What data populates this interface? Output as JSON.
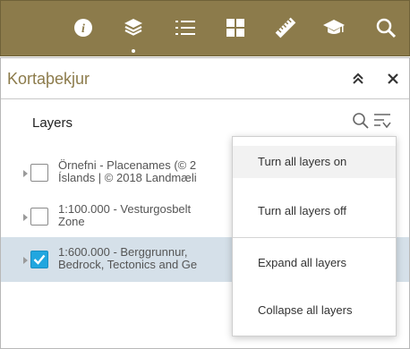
{
  "toolbar": {
    "buttons": [
      {
        "name": "info-icon"
      },
      {
        "name": "layers-icon",
        "active": true
      },
      {
        "name": "legend-list-icon"
      },
      {
        "name": "basemap-grid-icon"
      },
      {
        "name": "measure-ruler-icon"
      },
      {
        "name": "education-cap-icon"
      },
      {
        "name": "search-icon"
      }
    ],
    "background": "#8c7b4b"
  },
  "panel": {
    "title": "Kortaþekjur",
    "collapse_icon": "double-chevron-up-icon",
    "close_icon": "close-icon"
  },
  "layers": {
    "heading": "Layers",
    "items": [
      {
        "line1": "Örnefni - Placenames (© 2",
        "line2": "Íslands | © 2018 Landmæli",
        "checked": false
      },
      {
        "line1": "1:100.000 - Vesturgosbelt",
        "line2": "Zone",
        "checked": false
      },
      {
        "line1": "1:600.000 - Berggrunnur,",
        "line2": "Bedrock, Tectonics and Ge",
        "checked": true
      }
    ]
  },
  "menu": {
    "items": [
      {
        "label": "Turn all layers on",
        "hover": true
      },
      {
        "label": "Turn all layers off"
      },
      {
        "label": "Expand all layers"
      },
      {
        "label": "Collapse all layers"
      }
    ]
  },
  "colors": {
    "accent": "#8c7b4b",
    "checkbox_checked": "#21a6df",
    "selected_row": "#d5e0e9"
  }
}
